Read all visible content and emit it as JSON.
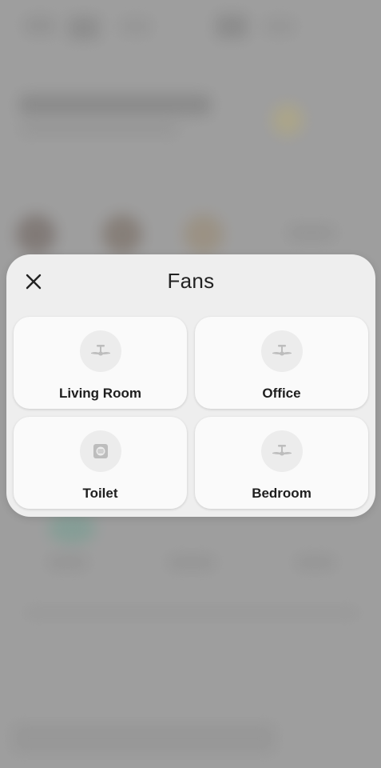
{
  "dialog": {
    "title": "Fans",
    "close_icon": "close-icon",
    "devices": [
      {
        "label": "Living Room",
        "icon": "ceiling-fan-icon"
      },
      {
        "label": "Office",
        "icon": "ceiling-fan-icon"
      },
      {
        "label": "Toilet",
        "icon": "exhaust-fan-icon"
      },
      {
        "label": "Bedroom",
        "icon": "ceiling-fan-icon"
      }
    ]
  },
  "colors": {
    "dialog_bg": "#eeeeee",
    "tile_bg": "#fafafa",
    "icon_circle": "#ececec",
    "icon_glyph": "#bdbdbd",
    "text": "#1e1e1e",
    "backdrop": "#a5a5a5"
  }
}
